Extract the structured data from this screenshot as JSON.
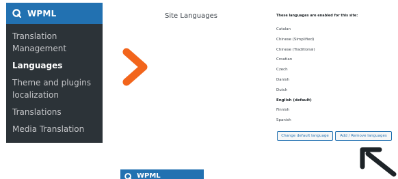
{
  "menu": {
    "brand": "WPML",
    "logo_icon": "wpml-logo-icon",
    "items": [
      {
        "label": "Translation Management",
        "active": false
      },
      {
        "label": "Languages",
        "active": true
      },
      {
        "label": "Theme and plugins localization",
        "active": false
      },
      {
        "label": "Translations",
        "active": false
      },
      {
        "label": "Media Translation",
        "active": false
      }
    ]
  },
  "settings": {
    "heading": "Site Languages",
    "enabled_label": "These languages are enabled for this site:",
    "languages": [
      {
        "name": "Catalan",
        "default": false
      },
      {
        "name": "Chinese (Simplified)",
        "default": false
      },
      {
        "name": "Chinese (Traditional)",
        "default": false
      },
      {
        "name": "Croatian",
        "default": false
      },
      {
        "name": "Czech",
        "default": false
      },
      {
        "name": "Danish",
        "default": false
      },
      {
        "name": "Dutch",
        "default": false
      },
      {
        "name": "English (default)",
        "default": true
      },
      {
        "name": "Finnish",
        "default": false
      },
      {
        "name": "Spanish",
        "default": false
      }
    ],
    "change_default_label": "Change default language",
    "add_remove_label": "Add / Remove languages"
  },
  "header_2": {
    "brand": "WPML"
  },
  "colors": {
    "menu_bg": "#2c3338",
    "header_blue": "#2271b1",
    "chevron_orange": "#f2651c",
    "pointer_dark": "#1d2327"
  }
}
